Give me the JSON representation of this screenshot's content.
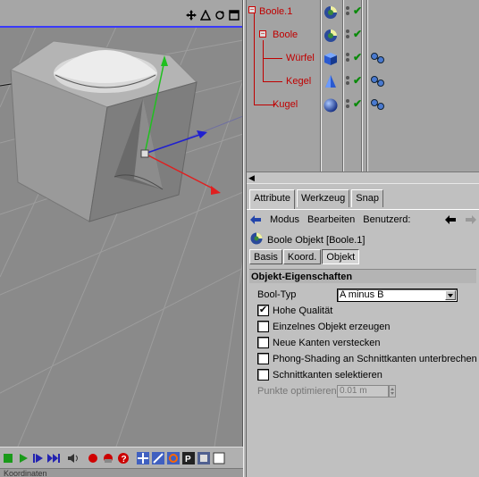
{
  "viewport": {
    "view_icons": [
      "move-icon",
      "rotate-view-icon",
      "cycle-icon",
      "maximize-icon"
    ]
  },
  "object_manager": {
    "objects": [
      {
        "name": "Boole.1",
        "icon": "boole-icon"
      },
      {
        "name": "Boole",
        "icon": "boole-icon"
      },
      {
        "name": "Würfel",
        "icon": "cube-icon"
      },
      {
        "name": "Kegel",
        "icon": "cone-icon"
      },
      {
        "name": "Kugel",
        "icon": "sphere-icon"
      }
    ],
    "label_color": "#c00000",
    "check_color": "#0a8a0a"
  },
  "attribute_manager": {
    "tabs": [
      "Attribute",
      "Werkzeug",
      "Snap"
    ],
    "menu": [
      "Modus",
      "Bearbeiten",
      "Benutzerd:"
    ],
    "object_title": "Boole Objekt [Boole.1]",
    "subtabs": [
      "Basis",
      "Koord.",
      "Objekt"
    ],
    "section_title": "Objekt-Eigenschaften",
    "bool_type_label": "Bool-Typ",
    "bool_type_value": "A minus B",
    "options": [
      {
        "label": "Hohe Qualität",
        "checked": true
      },
      {
        "label": "Einzelnes Objekt erzeugen",
        "checked": false
      },
      {
        "label": "Neue Kanten verstecken",
        "checked": false
      },
      {
        "label": "Phong-Shading an Schnittkanten unterbrechen",
        "checked": false
      },
      {
        "label": "Schnittkanten selektieren",
        "checked": false
      }
    ],
    "punkte_label": "Punkte optimieren",
    "punkte_value": "0.01 m"
  },
  "status": {
    "label": "Koordinaten"
  },
  "colors": {
    "accent_blue": "#3a3aff",
    "axis_x": "#e02020",
    "axis_y": "#20c020",
    "axis_z": "#2020d0"
  }
}
